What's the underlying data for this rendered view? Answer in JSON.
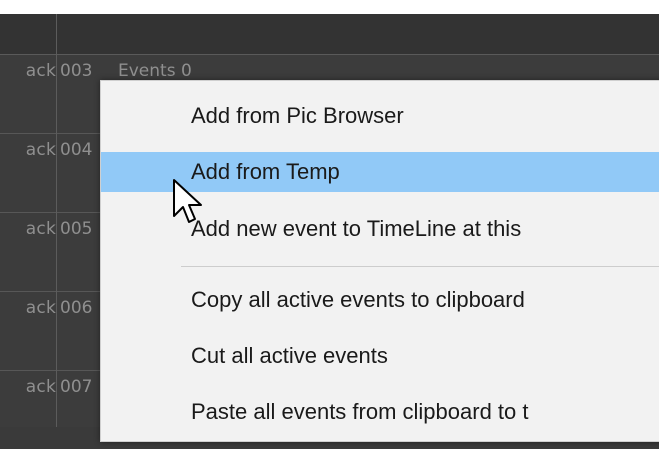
{
  "timeline": {
    "tracks": [
      {
        "label": "ack",
        "num": "003",
        "events": "Events 0"
      },
      {
        "label": "ack",
        "num": "004",
        "events": ""
      },
      {
        "label": "ack",
        "num": "005",
        "events": ""
      },
      {
        "label": "ack",
        "num": "006",
        "events": ""
      },
      {
        "label": "ack",
        "num": "007",
        "events": ""
      }
    ]
  },
  "context_menu": {
    "items": [
      {
        "label": "Add from Pic Browser"
      },
      {
        "label": "Add from Temp"
      },
      {
        "label": "Add new event to TimeLine at this"
      },
      {
        "label": "Copy all active events to clipboard"
      },
      {
        "label": "Cut all active events"
      },
      {
        "label": "Paste all events from clipboard to t"
      }
    ],
    "highlighted_index": 1
  },
  "colors": {
    "highlight": "#91c9f7",
    "menu_bg": "#f2f2f2",
    "timeline_bg": "#3c3c3c"
  },
  "icons": {
    "cursor": "mouse-pointer-icon"
  }
}
